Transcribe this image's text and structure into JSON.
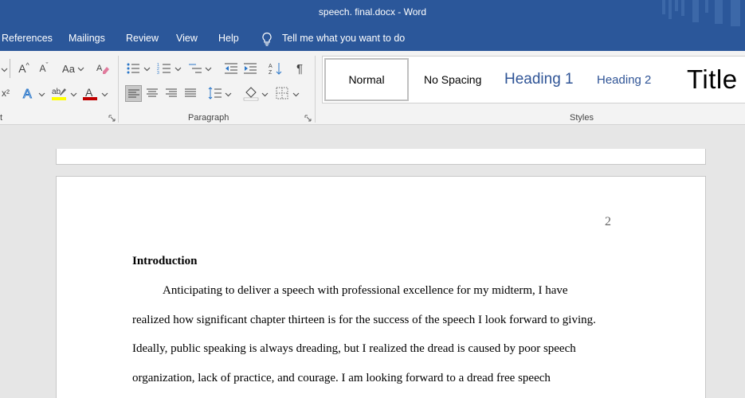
{
  "window": {
    "title": "speech. final.docx  -  Word"
  },
  "tabs": [
    {
      "label": "References"
    },
    {
      "label": "Mailings"
    },
    {
      "label": "Review"
    },
    {
      "label": "View"
    },
    {
      "label": "Help"
    }
  ],
  "tell_me": {
    "label": "Tell me what you want to do"
  },
  "ribbon": {
    "font_group": {
      "label": "t",
      "grow_font": "A",
      "shrink_font": "A",
      "change_case": "Aa",
      "superscript": "x²",
      "font_color_hex": "#c00000",
      "highlight_color_hex": "#ffff00"
    },
    "paragraph_group": {
      "label": "Paragraph"
    },
    "styles_group": {
      "label": "Styles",
      "items": [
        {
          "label": "Normal"
        },
        {
          "label": "No Spacing"
        },
        {
          "label": "Heading 1"
        },
        {
          "label": "Heading 2"
        },
        {
          "label": "Title"
        }
      ]
    }
  },
  "document": {
    "page_number": "2",
    "heading": "Introduction",
    "lines": [
      "Anticipating to deliver a speech with professional excellence for my midterm, I have",
      "realized how significant chapter thirteen is for the success of the speech I look forward to giving.",
      "Ideally, public speaking is always dreading, but I realized the dread is caused by poor speech",
      "organization, lack of practice, and courage. I am looking forward to a dread free speech"
    ]
  },
  "colors": {
    "ribbon_blue": "#2b579a",
    "heading_blue": "#2f5496"
  }
}
